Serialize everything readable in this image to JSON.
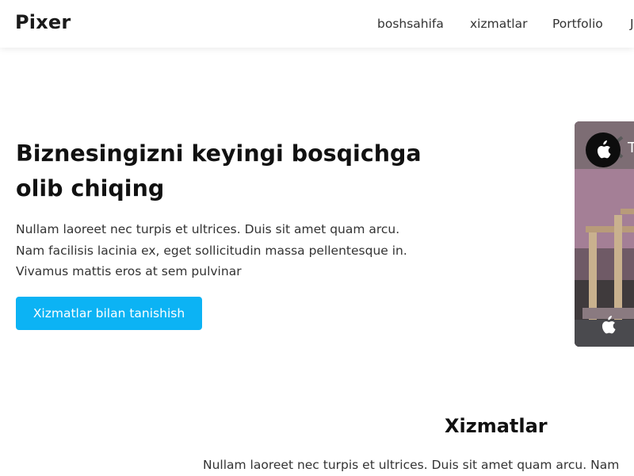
{
  "brand": {
    "logo_text": "Pixer"
  },
  "nav": {
    "items": [
      {
        "label": "boshsahifa"
      },
      {
        "label": "xizmatlar"
      },
      {
        "label": "Portfolio"
      },
      {
        "label": "J"
      }
    ]
  },
  "hero": {
    "title": "Biznesingizni keyingi bosqichga olib chiqing",
    "text": "Nullam laoreet nec turpis et ultrices. Duis sit amet quam arcu. Nam facilisis lacinia ex, eget sollicitudin massa pellentesque in. Vivamus mattis eros at sem pulvinar",
    "button_label": "Xizmatlar bilan tanishish"
  },
  "media": {
    "title_fragment": "T",
    "icon": "apple-icon"
  },
  "services": {
    "title": "Xizmatlar",
    "text": "Nullam laoreet nec turpis et ultrices. Duis sit amet quam arcu. Nam"
  },
  "colors": {
    "accent": "#0cb3f4",
    "text_dark": "#111111",
    "text_body": "#333333"
  }
}
